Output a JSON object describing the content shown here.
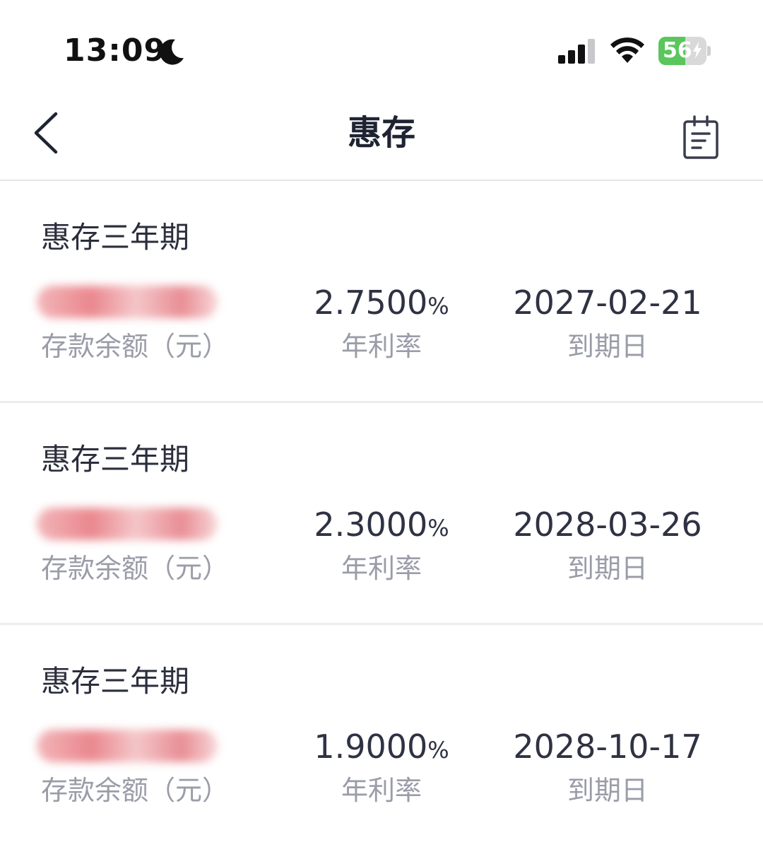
{
  "status_bar": {
    "time": "13:09",
    "battery_percent": 56,
    "battery_label": "56",
    "signal_bars_filled": 3,
    "signal_bars_total": 4,
    "colors": {
      "battery_fill": "#5ac65c"
    }
  },
  "nav": {
    "title": "惠存",
    "back_icon": "chevron-left-icon",
    "record_icon": "clipboard-list-icon"
  },
  "deposits": [
    {
      "product": "惠存三年期",
      "amount_label": "存款余额（元）",
      "rate": "2.7500",
      "rate_unit": "%",
      "rate_label": "年利率",
      "maturity": "2027-02-21",
      "maturity_label": "到期日"
    },
    {
      "product": "惠存三年期",
      "amount_label": "存款余额（元）",
      "rate": "2.3000",
      "rate_unit": "%",
      "rate_label": "年利率",
      "maturity": "2028-03-26",
      "maturity_label": "到期日"
    },
    {
      "product": "惠存三年期",
      "amount_label": "存款余额（元）",
      "rate": "1.9000",
      "rate_unit": "%",
      "rate_label": "年利率",
      "maturity": "2028-10-17",
      "maturity_label": "到期日"
    }
  ]
}
